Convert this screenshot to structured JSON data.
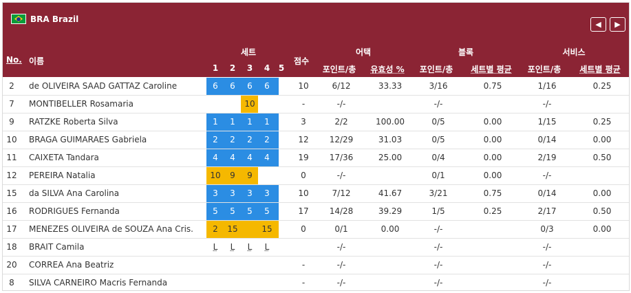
{
  "team": {
    "code_name": "BRA Brazil",
    "flag": "brazil-flag-icon"
  },
  "nav": {
    "prev": "◀",
    "next": "▶"
  },
  "headers": {
    "no": "No.",
    "name": "이름",
    "sets": "세트",
    "set_numbers": [
      "1",
      "2",
      "3",
      "4",
      "5"
    ],
    "points": "점수",
    "attack": "어택",
    "attack_pts": "포인트/총",
    "attack_eff": "유효성 %",
    "block": "블록",
    "block_pts": "포인트/총",
    "block_avg": "세트별 평균",
    "serve": "서비스",
    "serve_pts": "포인트/총",
    "serve_avg": "세트별 평균"
  },
  "colors": {
    "header_bg": "#8b2434",
    "starter_blue": "#2b8de3",
    "sub_gold": "#f5b800"
  },
  "players": [
    {
      "no": "2",
      "name": "de OLIVEIRA SAAD GATTAZ Caroline",
      "sets": [
        "6",
        "6",
        "6",
        "6",
        ""
      ],
      "fill": "blue",
      "fill_from": 1,
      "fill_to": 4,
      "pts": "10",
      "att": "6/12",
      "eff": "33.33",
      "blk": "3/16",
      "blk_avg": "0.75",
      "srv": "1/16",
      "srv_avg": "0.25"
    },
    {
      "no": "7",
      "name": "MONTIBELLER Rosamaria",
      "sets": [
        "",
        "",
        "10",
        "",
        ""
      ],
      "fill": "gold",
      "fill_from": 3,
      "fill_to": 3,
      "pts": "-",
      "att": "-/-",
      "eff": "",
      "blk": "-/-",
      "blk_avg": "",
      "srv": "-/-",
      "srv_avg": ""
    },
    {
      "no": "9",
      "name": "RATZKE Roberta Silva",
      "sets": [
        "1",
        "1",
        "1",
        "1",
        ""
      ],
      "fill": "blue",
      "fill_from": 1,
      "fill_to": 4,
      "pts": "3",
      "att": "2/2",
      "eff": "100.00",
      "blk": "0/5",
      "blk_avg": "0.00",
      "srv": "1/15",
      "srv_avg": "0.25"
    },
    {
      "no": "10",
      "name": "BRAGA GUIMARAES Gabriela",
      "sets": [
        "2",
        "2",
        "2",
        "2",
        ""
      ],
      "fill": "blue",
      "fill_from": 1,
      "fill_to": 4,
      "pts": "12",
      "att": "12/29",
      "eff": "31.03",
      "blk": "0/5",
      "blk_avg": "0.00",
      "srv": "0/14",
      "srv_avg": "0.00"
    },
    {
      "no": "11",
      "name": "CAIXETA Tandara",
      "sets": [
        "4",
        "4",
        "4",
        "4",
        ""
      ],
      "fill": "blue",
      "fill_from": 1,
      "fill_to": 4,
      "pts": "19",
      "att": "17/36",
      "eff": "25.00",
      "blk": "0/4",
      "blk_avg": "0.00",
      "srv": "2/19",
      "srv_avg": "0.50"
    },
    {
      "no": "12",
      "name": "PEREIRA Natalia",
      "sets": [
        "10",
        "9",
        "9",
        "",
        ""
      ],
      "fill": "gold",
      "fill_from": 1,
      "fill_to": 3,
      "pts": "0",
      "att": "-/-",
      "eff": "",
      "blk": "0/1",
      "blk_avg": "0.00",
      "srv": "-/-",
      "srv_avg": ""
    },
    {
      "no": "15",
      "name": "da SILVA Ana Carolina",
      "sets": [
        "3",
        "3",
        "3",
        "3",
        ""
      ],
      "fill": "blue",
      "fill_from": 1,
      "fill_to": 4,
      "pts": "10",
      "att": "7/12",
      "eff": "41.67",
      "blk": "3/21",
      "blk_avg": "0.75",
      "srv": "0/14",
      "srv_avg": "0.00"
    },
    {
      "no": "16",
      "name": "RODRIGUES Fernanda",
      "sets": [
        "5",
        "5",
        "5",
        "5",
        ""
      ],
      "fill": "blue",
      "fill_from": 1,
      "fill_to": 4,
      "pts": "17",
      "att": "14/28",
      "eff": "39.29",
      "blk": "1/5",
      "blk_avg": "0.25",
      "srv": "2/17",
      "srv_avg": "0.50"
    },
    {
      "no": "17",
      "name": "MENEZES OLIVEIRA de SOUZA Ana Cris.",
      "sets": [
        "2",
        "15",
        "",
        "15",
        ""
      ],
      "fill": "gold",
      "fill_from": 1,
      "fill_to": 4,
      "pts": "0",
      "att": "0/1",
      "eff": "0.00",
      "blk": "-/-",
      "blk_avg": "",
      "srv": "0/3",
      "srv_avg": "0.00"
    },
    {
      "no": "18",
      "name": "BRAIT Camila",
      "sets": [
        "L",
        "L",
        "L",
        "L",
        ""
      ],
      "fill": "none",
      "fill_from": 0,
      "fill_to": 0,
      "pts": "",
      "att": "-/-",
      "eff": "",
      "blk": "-/-",
      "blk_avg": "",
      "srv": "-/-",
      "srv_avg": ""
    },
    {
      "no": "20",
      "name": "CORREA Ana Beatriz",
      "sets": [
        "",
        "",
        "",
        "",
        ""
      ],
      "fill": "none",
      "fill_from": 0,
      "fill_to": 0,
      "pts": "-",
      "att": "-/-",
      "eff": "",
      "blk": "-/-",
      "blk_avg": "",
      "srv": "-/-",
      "srv_avg": ""
    },
    {
      "no": "8",
      "name": "SILVA CARNEIRO Macris Fernanda",
      "sets": [
        "",
        "",
        "",
        "",
        ""
      ],
      "fill": "none",
      "fill_from": 0,
      "fill_to": 0,
      "pts": "-",
      "att": "-/-",
      "eff": "",
      "blk": "-/-",
      "blk_avg": "",
      "srv": "-/-",
      "srv_avg": ""
    }
  ]
}
